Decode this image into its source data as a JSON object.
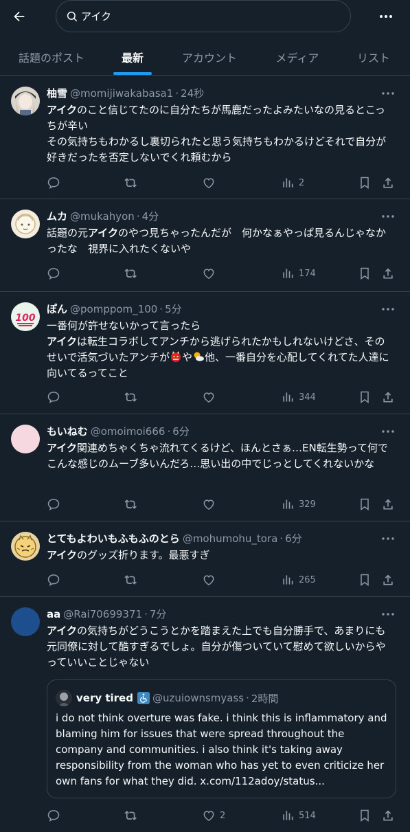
{
  "search": {
    "value": "アイク"
  },
  "tabs": [
    {
      "label": "話題のポスト"
    },
    {
      "label": "最新"
    },
    {
      "label": "アカウント"
    },
    {
      "label": "メディア"
    },
    {
      "label": "リスト"
    }
  ],
  "colors": {
    "background": "#15202b",
    "accent": "#1d9bf0",
    "muted": "#8b98a5",
    "border": "#38444d"
  },
  "posts": [
    {
      "name": "柚雪",
      "handle": "@momijiwakabasa1",
      "time": "24秒",
      "keyword": "アイク",
      "text_a": "のこと信じてたのに自分たちが馬鹿だったよみたいなの見るとこっちが辛い",
      "text_b": "その気持ちもわかるし裏切られたと思う気持ちもわかるけどそれで自分が好きだったを否定しないでくれ頼むから",
      "like_count": "",
      "views": "2"
    },
    {
      "name": "ムカ",
      "handle": "@mukahyon",
      "time": "4分",
      "prefix": "話題の元",
      "keyword": "アイク",
      "text_a": "のやつ見ちゃったんだが　何かなぁやっぱ見るんじゃなかったな　視界に入れたくないや",
      "like_count": "",
      "views": "174"
    },
    {
      "name": "ぽん",
      "handle": "@pomppom_100",
      "time": "5分",
      "line1": "一番何が許せないかって言ったら",
      "keyword": "アイク",
      "text_a": "は転生コラボしてアンチから逃げられたかもしれないけどさ、そのせいで活気づいたアンチが",
      "mid": "や",
      "text_b": "他、一番自分を心配してくれてた人達に向いてるってこと",
      "like_count": "",
      "views": "344"
    },
    {
      "name": "もいねむ",
      "handle": "@omoimoi666",
      "time": "6分",
      "keyword": "アイク",
      "text_a": "関連めちゃくちゃ流れてくるけど、ほんとさぁ…EN転生勢って何でこんな感じのムーブ多いんだろ…思い出の中でじっとしてくれないかな",
      "like_count": "",
      "views": "329"
    },
    {
      "name": "とてもよわいもふもふのとら",
      "handle": "@mohumohu_tora",
      "time": "6分",
      "keyword": "アイク",
      "text_a": "のグッズ折ります。最悪すぎ",
      "like_count": "",
      "views": "265"
    },
    {
      "name": "aa",
      "handle": "@Rai70699371",
      "time": "7分",
      "keyword": "アイク",
      "text_a": "の気持ちがどうこうとかを踏まえた上でも自分勝手で、あまりにも元同僚に対して酷すぎるでしょ。自分が傷ついていて慰めて欲しいからやっていいことじゃない",
      "like_count": "2",
      "views": "514",
      "quote": {
        "name": "very tired",
        "handle": "@uzuiownsmyass",
        "time": "2時間",
        "text": "i do not think overture was fake. i think this is inflammatory and blaming him for issues that were spread throughout the company and communities. i also think it's taking away responsibility from the woman who has yet to even criticize her own fans for what they did. x.com/112adoy/status..."
      }
    }
  ]
}
